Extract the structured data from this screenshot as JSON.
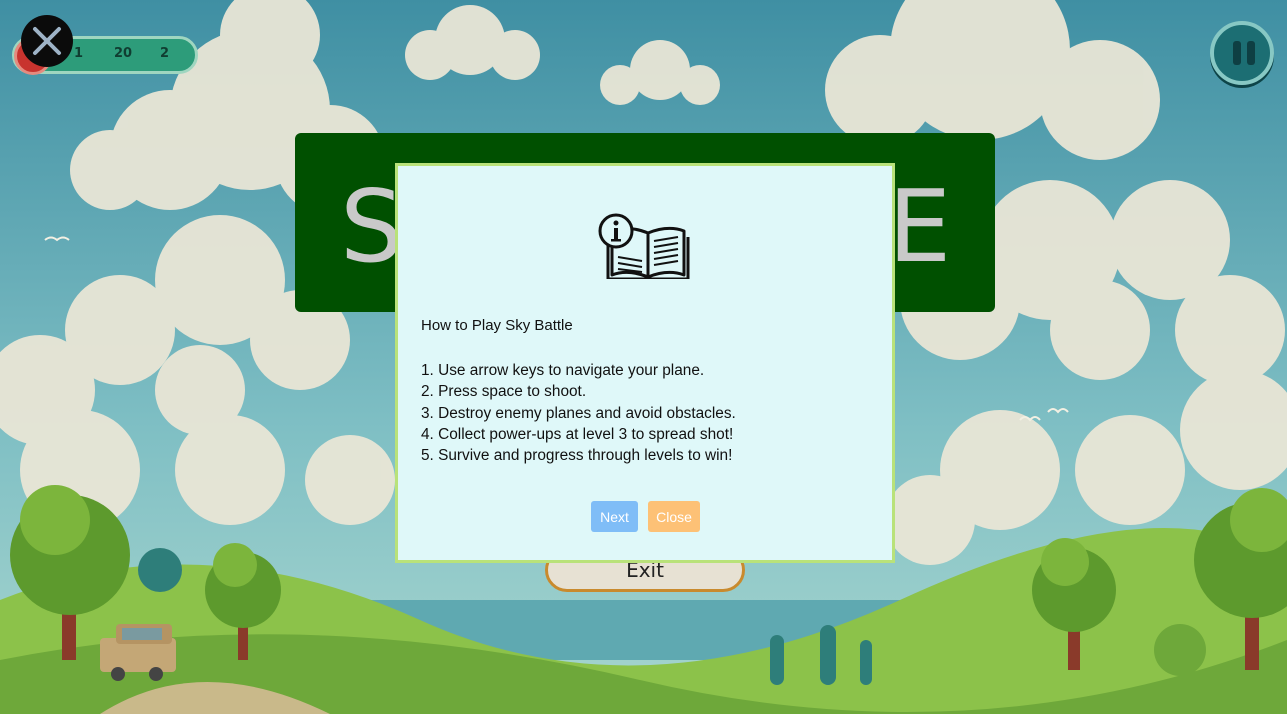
{
  "hud": {
    "lives": "1",
    "score": "20",
    "level": "2"
  },
  "title": {
    "left": "S",
    "right": "E"
  },
  "menu": {
    "exit_label": "Exit"
  },
  "modal": {
    "icon": "info-book-icon",
    "title": "How to Play Sky Battle",
    "steps": [
      "1. Use arrow keys to navigate your plane.",
      "2. Press space to shoot.",
      "3. Destroy enemy planes and avoid obstacles.",
      "4. Collect power-ups at level 3 to spread shot!",
      "5. Survive and progress through levels to win!"
    ],
    "next_label": "Next",
    "close_label": "Close"
  },
  "colors": {
    "sky": "#5aa6b6",
    "board": "#005000",
    "modal_bg": "#dff8f9",
    "modal_border": "#b9e27a",
    "next_button": "#7fbdf7",
    "close_button": "#fdc176"
  }
}
